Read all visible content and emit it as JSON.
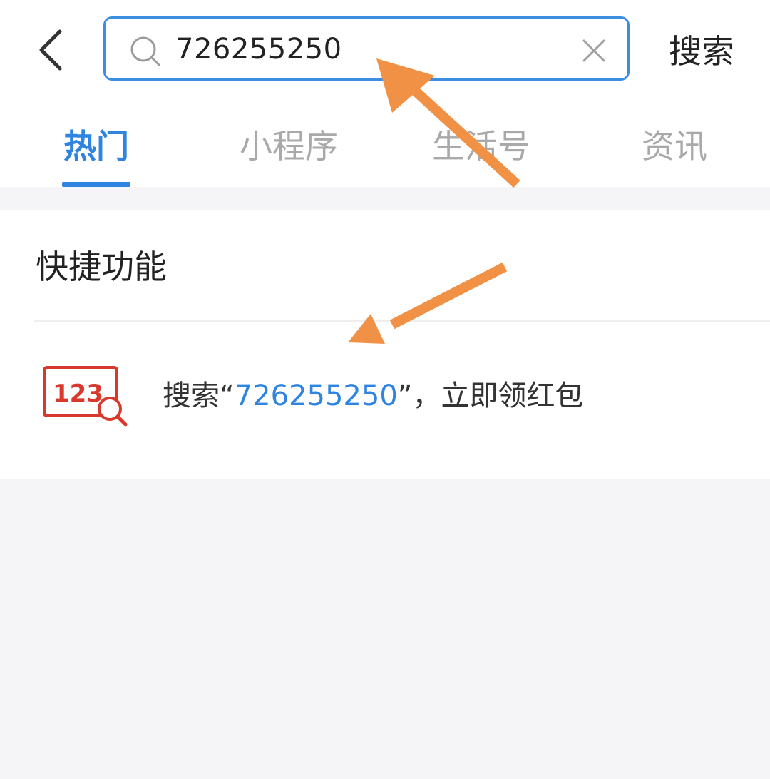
{
  "search": {
    "query": "726255250",
    "submit_label": "搜索"
  },
  "tabs": [
    {
      "label": "热门",
      "active": true
    },
    {
      "label": "小程序",
      "active": false
    },
    {
      "label": "生活号",
      "active": false
    },
    {
      "label": "资讯",
      "active": false
    }
  ],
  "quick_functions": {
    "title": "快捷功能",
    "item": {
      "prefix": "搜索“",
      "number": "726255250",
      "suffix": "”，立即领红包"
    }
  },
  "icons": {
    "back": "chevron-left-icon",
    "search": "search-icon",
    "clear": "close-icon",
    "number_search": "number-search-icon"
  },
  "colors": {
    "accent": "#2f83e1",
    "search_border": "#3b8ee0",
    "icon_red": "#d9382d",
    "annotation_arrow": "#f09146",
    "inactive_tab": "#a9a9a9",
    "background": "#f5f5f7"
  }
}
